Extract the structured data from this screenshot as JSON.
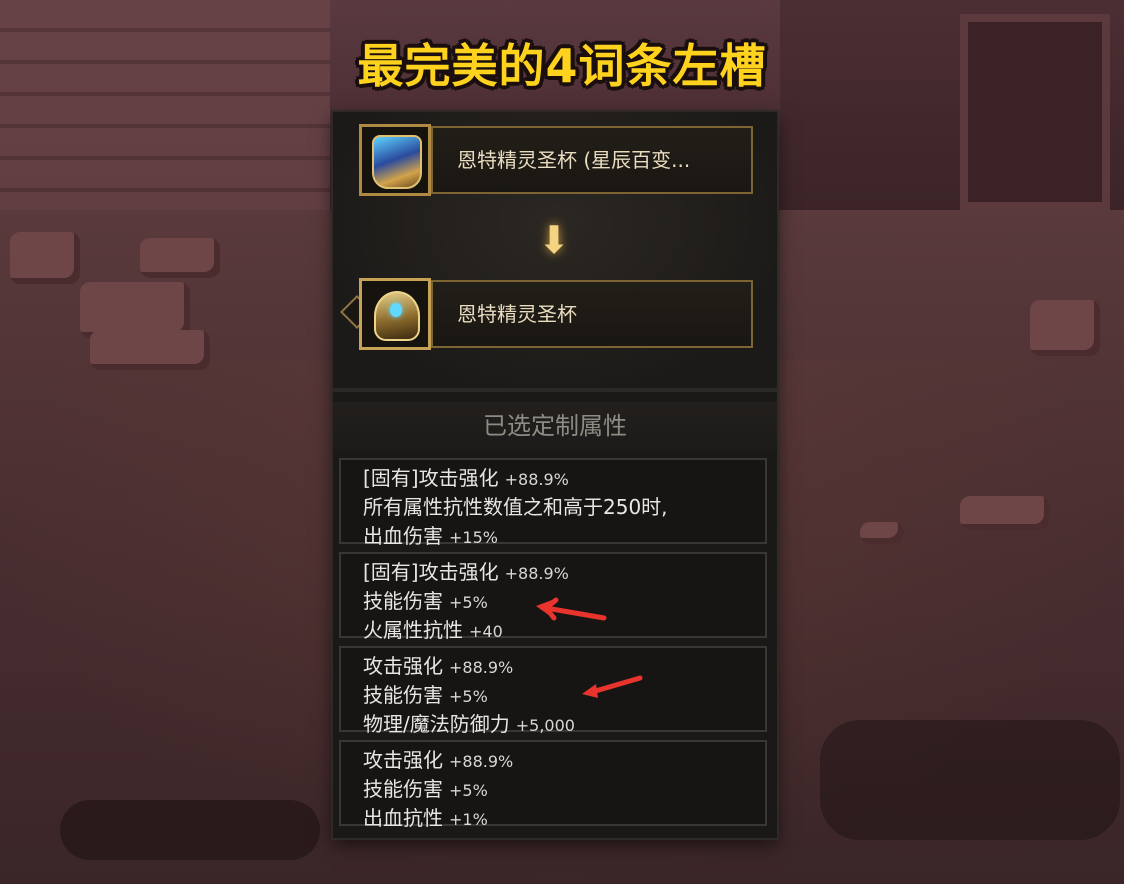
{
  "title": "最完美的4词条左槽",
  "source_item": {
    "name": "恩特精灵圣杯 (星辰百变...",
    "icon": "chalice-icon"
  },
  "target_item": {
    "name": "恩特精灵圣杯",
    "icon": "chalice-icon"
  },
  "arrow": "⬇",
  "section_title": "已选定制属性",
  "options": [
    {
      "lines": [
        {
          "text": "[固有]攻击强化",
          "value": "+88.9%"
        },
        {
          "text": "所有属性抗性数值之和高于250时,",
          "value": ""
        },
        {
          "text": "出血伤害",
          "value": "+15%"
        }
      ]
    },
    {
      "lines": [
        {
          "text": "[固有]攻击强化",
          "value": "+88.9%"
        },
        {
          "text": "技能伤害",
          "value": "+5%"
        },
        {
          "text": "火属性抗性",
          "value": "+40"
        }
      ]
    },
    {
      "lines": [
        {
          "text": "攻击强化",
          "value": "+88.9%"
        },
        {
          "text": "技能伤害",
          "value": "+5%"
        },
        {
          "text": "物理/魔法防御力",
          "value": "+5,000"
        }
      ]
    },
    {
      "lines": [
        {
          "text": "攻击强化",
          "value": "+88.9%"
        },
        {
          "text": "技能伤害",
          "value": "+5%"
        },
        {
          "text": "出血抗性",
          "value": "+1%"
        }
      ]
    }
  ],
  "colors": {
    "title": "#ffd21e",
    "annotation_arrow": "#e8342c",
    "panel_border": "#7d6533"
  }
}
